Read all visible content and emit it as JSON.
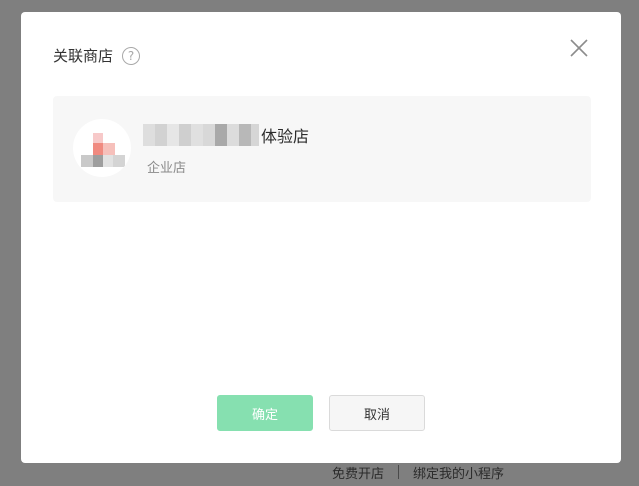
{
  "background_links": {
    "open_store": "免费开店",
    "bind_miniprogram": "绑定我的小程序"
  },
  "dialog": {
    "title": "关联商店",
    "help_icon_glyph": "?",
    "close_icon": "close-x-icon",
    "store": {
      "name_suffix": "体验店",
      "type": "企业店"
    },
    "buttons": {
      "confirm": "确定",
      "cancel": "取消"
    }
  },
  "colors": {
    "confirm_button": "#86e0b0",
    "backdrop": "#7f7f7f"
  }
}
